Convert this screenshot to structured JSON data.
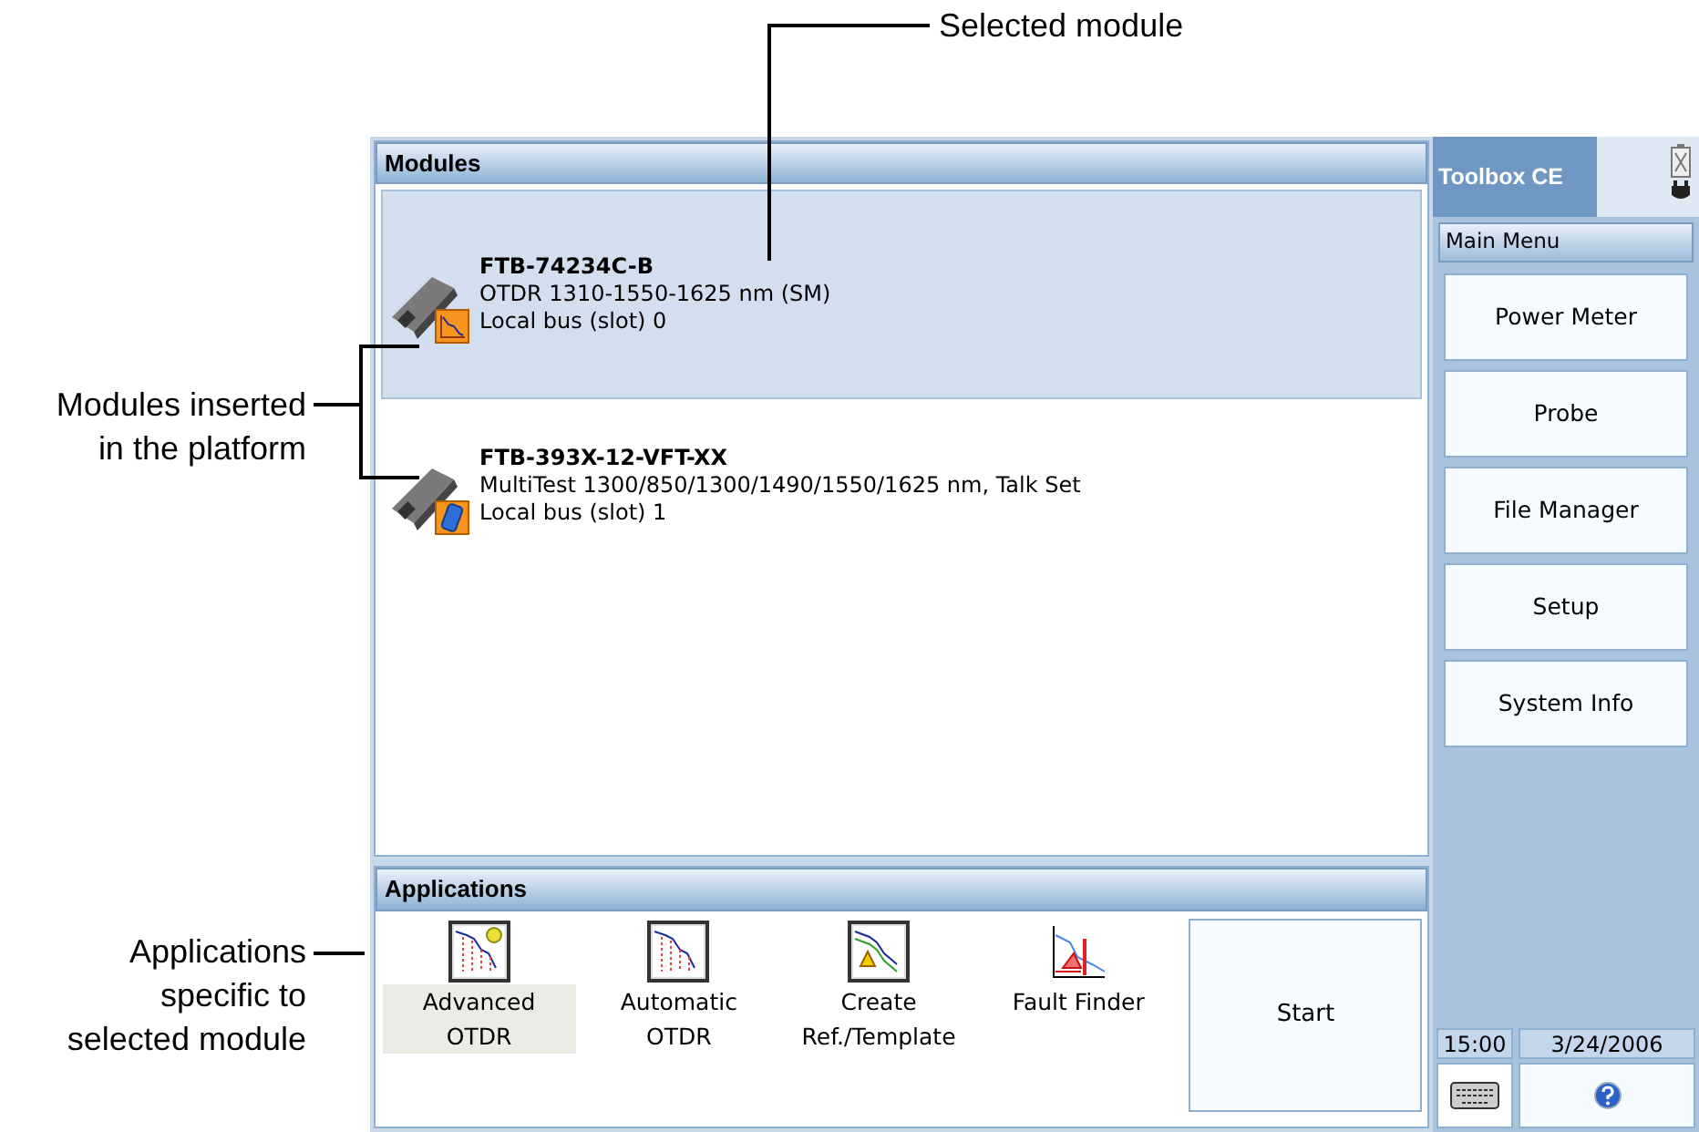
{
  "callouts": [
    {
      "lines": [
        "Selected module"
      ]
    },
    {
      "lines": [
        "Modules inserted",
        "in the platform"
      ]
    },
    {
      "lines": [
        "Applications",
        "specific to",
        "selected module"
      ]
    }
  ],
  "modules_panel": {
    "title": "Modules",
    "modules": [
      {
        "name": "FTB-74234C-B",
        "description": "OTDR 1310-1550-1625 nm (SM)",
        "location": "Local bus (slot) 0",
        "kind": "otdr",
        "selected": true
      },
      {
        "name": "FTB-393X-12-VFT-XX",
        "description": "MultiTest 1300/850/1300/1490/1550/1625 nm, Talk Set",
        "location": "Local bus (slot) 1",
        "kind": "multitest",
        "selected": false
      }
    ]
  },
  "applications_panel": {
    "title": "Applications",
    "applications": [
      {
        "label": "Advanced OTDR",
        "kind": "advanced",
        "selected": true
      },
      {
        "label": "Automatic OTDR",
        "kind": "automatic",
        "selected": false
      },
      {
        "label": "Create Ref./Template",
        "kind": "template",
        "selected": false
      },
      {
        "label": "Fault Finder",
        "kind": "fault",
        "selected": false
      }
    ],
    "start_button": "Start"
  },
  "sidebar": {
    "title": "Toolbox CE",
    "menu_title": "Main Menu",
    "items": [
      "Power Meter",
      "Probe",
      "File Manager",
      "Setup",
      "System Info"
    ],
    "time": "15:00",
    "date": "3/24/2006"
  }
}
